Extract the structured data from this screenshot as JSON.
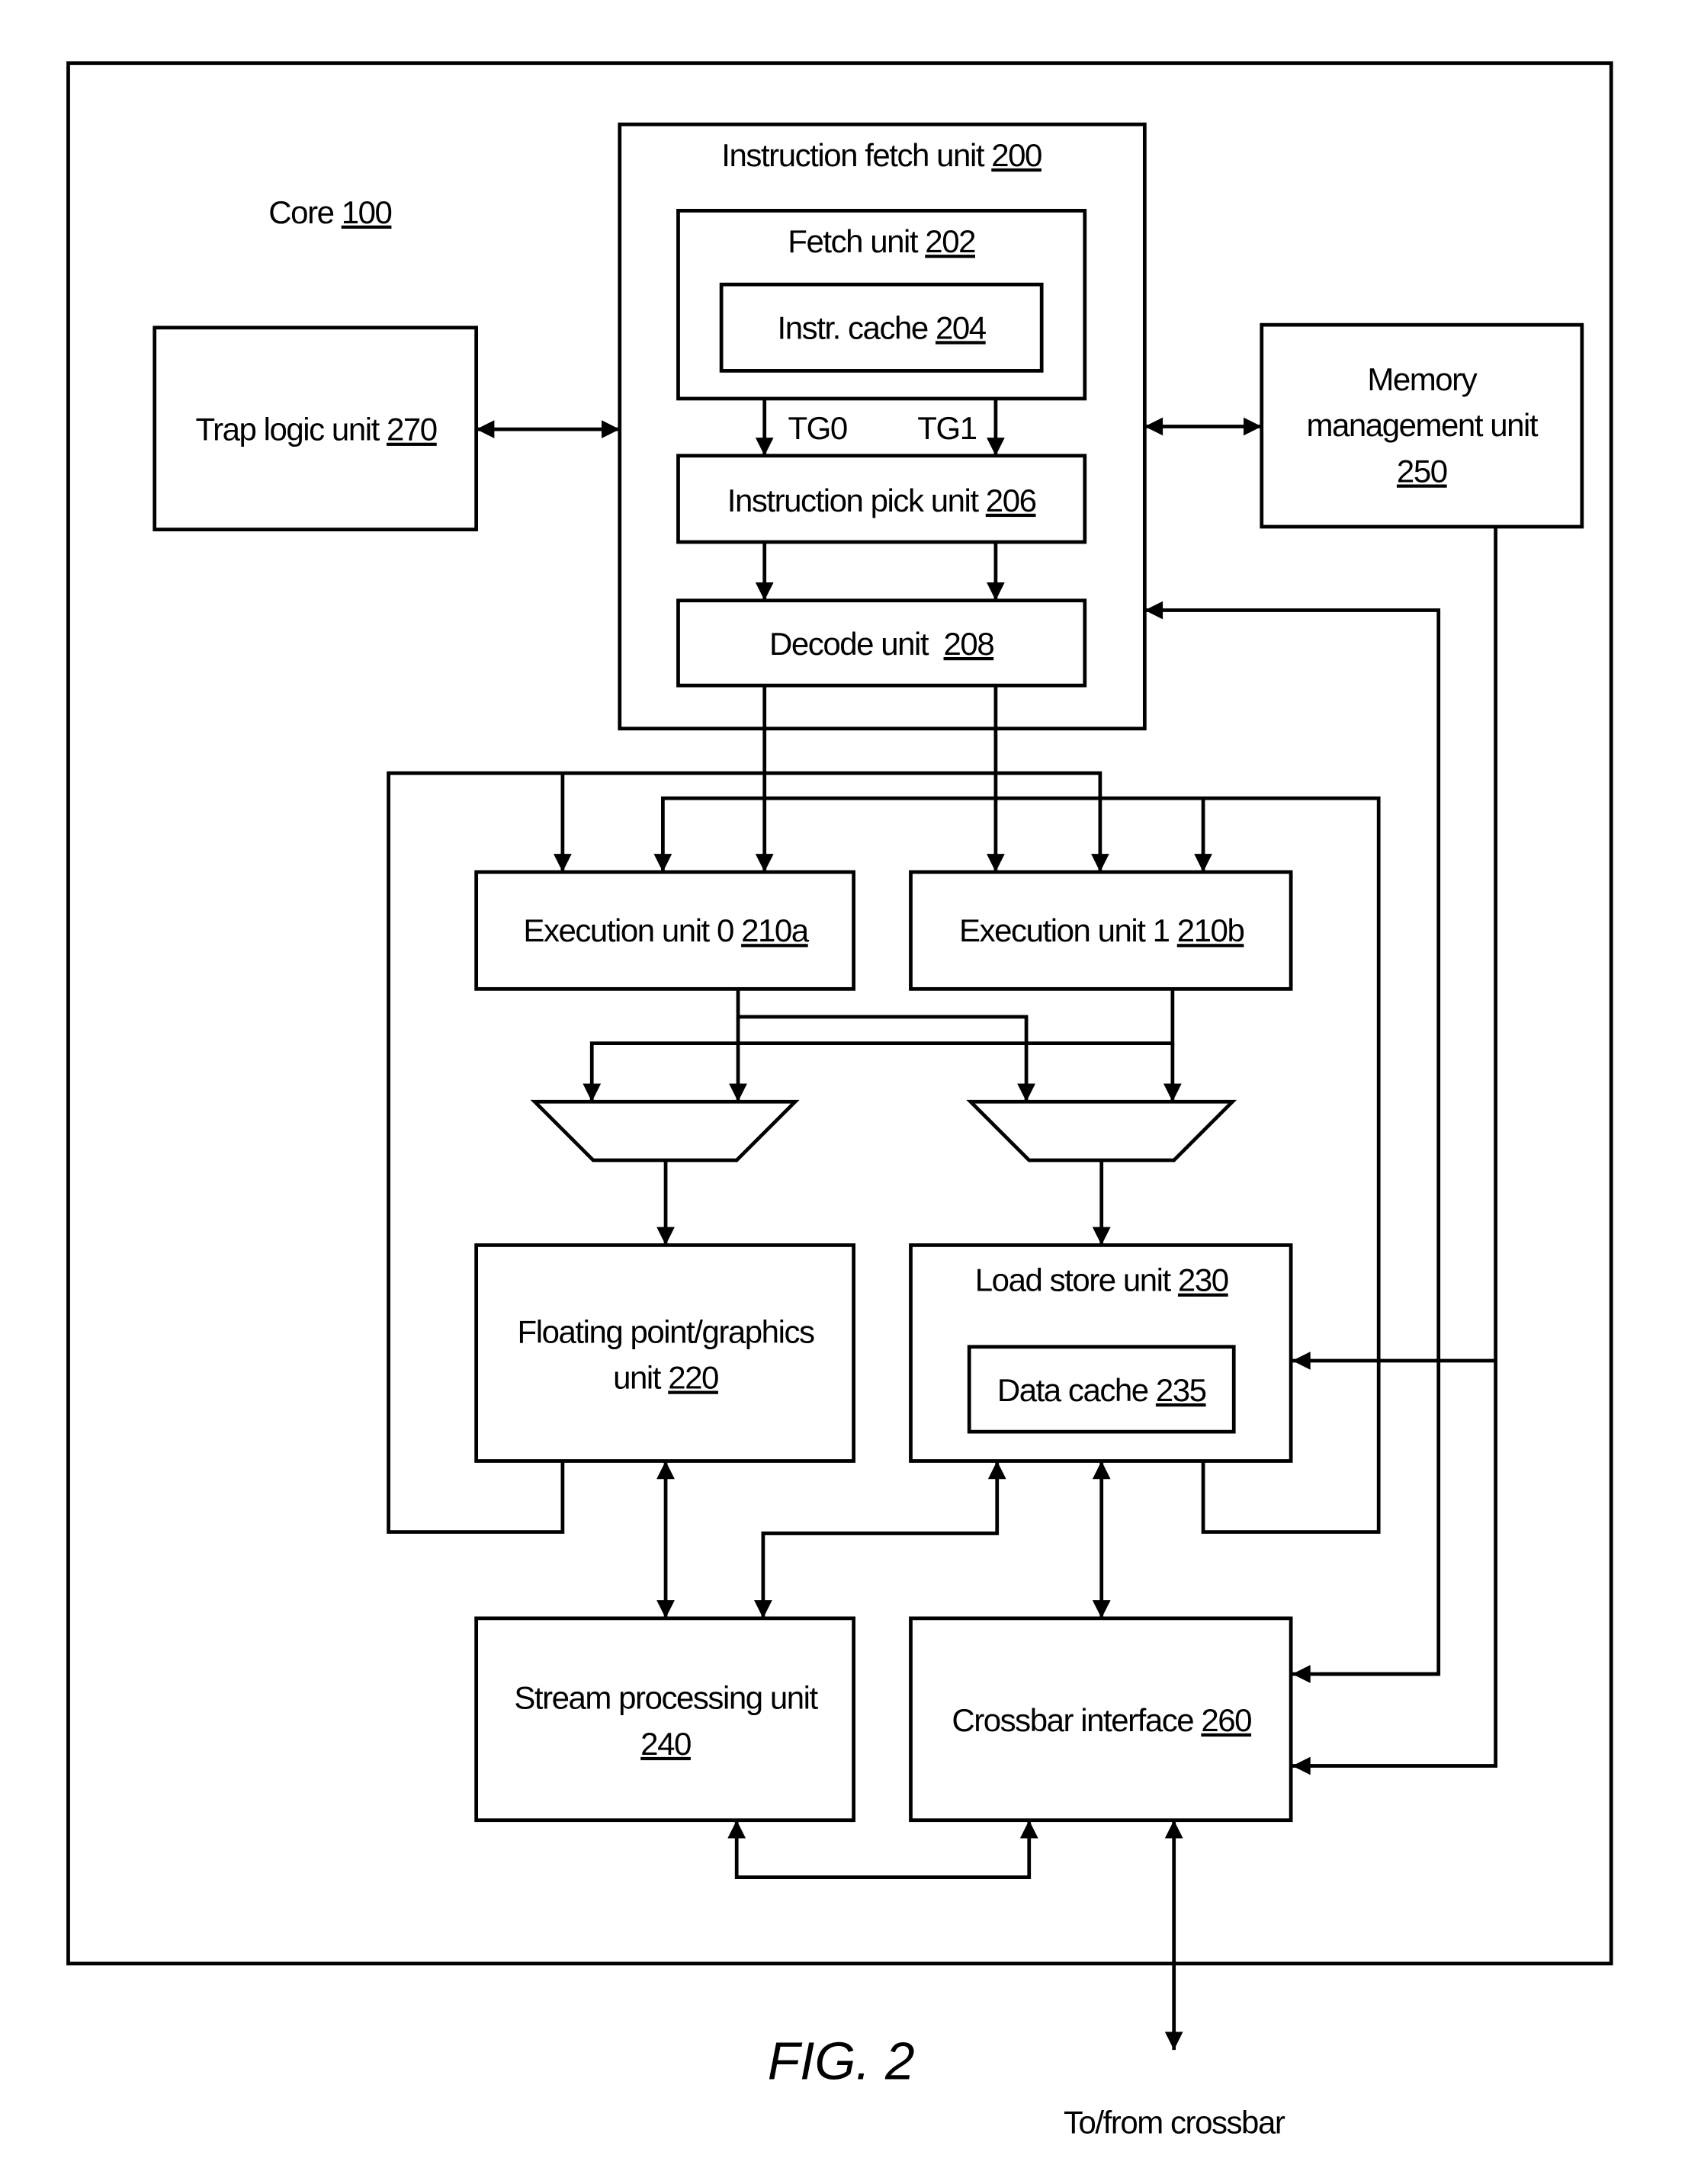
{
  "figure": {
    "caption": "FIG. 2"
  },
  "core": {
    "label": "Core ",
    "number": "100"
  },
  "blocks": {
    "ifu": {
      "label": "Instruction fetch unit ",
      "number": "200"
    },
    "fetch": {
      "label": "Fetch unit ",
      "number": "202"
    },
    "icache": {
      "label": "Instr. cache ",
      "number": "204"
    },
    "pick": {
      "label": "Instruction pick unit ",
      "number": "206"
    },
    "decode": {
      "label": "Decode unit  ",
      "number": "208"
    },
    "trap": {
      "label": "Trap logic unit ",
      "number": "270"
    },
    "mmu": {
      "line1": "Memory",
      "line2": "management unit",
      "number": "250"
    },
    "exu0": {
      "label": "Execution unit 0 ",
      "number": "210a"
    },
    "exu1": {
      "label": "Execution unit 1 ",
      "number": "210b"
    },
    "fgu": {
      "line1": "Floating point/graphics",
      "label": "unit ",
      "number": "220"
    },
    "lsu": {
      "label": "Load store unit ",
      "number": "230"
    },
    "dcache": {
      "label": "Data cache ",
      "number": "235"
    },
    "spu": {
      "line1": "Stream processing unit",
      "number": "240"
    },
    "xbar": {
      "label": "Crossbar interface ",
      "number": "260"
    }
  },
  "signals": {
    "tg0": "TG0",
    "tg1": "TG1"
  },
  "external": {
    "crossbar": "To/from crossbar"
  }
}
